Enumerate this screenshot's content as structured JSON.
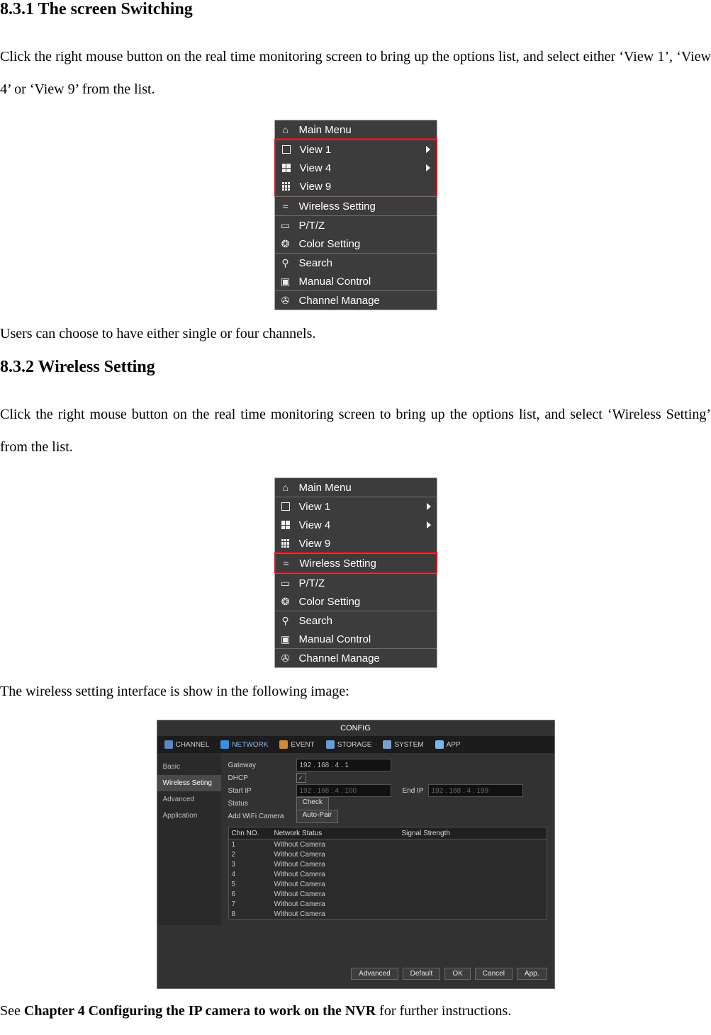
{
  "section831": {
    "heading": "8.3.1  The screen Switching",
    "para1": "Click the right mouse button on the real time monitoring screen to bring up the options list, and select either ‘View 1’, ‘View 4’ or ‘View 9’ from the list.",
    "para2": "Users can choose to have either single or four channels."
  },
  "section832": {
    "heading": "8.3.2  Wireless Setting",
    "para1": "Click the right mouse button on the real time monitoring screen to bring up the options list, and select ‘Wireless Setting’ from the list.",
    "para2": "The wireless setting interface is show in the following image:",
    "para3_prefix": "See ",
    "para3_bold": "Chapter 4 Configuring the IP camera to work on the NVR",
    "para3_suffix": " for further instructions."
  },
  "menu": {
    "main_menu": "Main Menu",
    "view1": "View 1",
    "view4": "View 4",
    "view9": "View 9",
    "wireless": "Wireless Setting",
    "ptz": "P/T/Z",
    "color": "Color Setting",
    "search": "Search",
    "manual": "Manual Control",
    "channel": "Channel Manage"
  },
  "config": {
    "title": "CONFIG",
    "tabs": {
      "channel": "CHANNEL",
      "network": "NETWORK",
      "event": "EVENT",
      "storage": "STORAGE",
      "system": "SYSTEM",
      "app": "APP"
    },
    "side": {
      "basic": "Basic",
      "wireless": "Wireless Seting",
      "advanced": "Advanced",
      "application": "Application"
    },
    "fields": {
      "gateway": "Gateway",
      "gateway_ip": "192  . 168   .  4    .  1",
      "dhcp": "DHCP",
      "start_ip": "Start IP",
      "start_ip_v": "192  . 168   .  4    . 100",
      "end_ip": "End IP",
      "end_ip_v": "192  . 168   .  4    . 199",
      "status": "Status",
      "check": "Check",
      "add_cam": "Add WiFi Camera",
      "auto_pair": "Auto-Pair"
    },
    "table": {
      "h1": "Chn NO.",
      "h2": "Network Status",
      "h3": "Signal Strength",
      "rows": [
        {
          "no": "1",
          "status": "Without Camera"
        },
        {
          "no": "2",
          "status": "Without Camera"
        },
        {
          "no": "3",
          "status": "Without Camera"
        },
        {
          "no": "4",
          "status": "Without Camera"
        },
        {
          "no": "5",
          "status": "Without Camera"
        },
        {
          "no": "6",
          "status": "Without Camera"
        },
        {
          "no": "7",
          "status": "Without Camera"
        },
        {
          "no": "8",
          "status": "Without Camera"
        }
      ]
    },
    "footer": {
      "advanced": "Advanced",
      "default": "Default",
      "ok": "OK",
      "cancel": "Cancel",
      "app": "App."
    }
  }
}
